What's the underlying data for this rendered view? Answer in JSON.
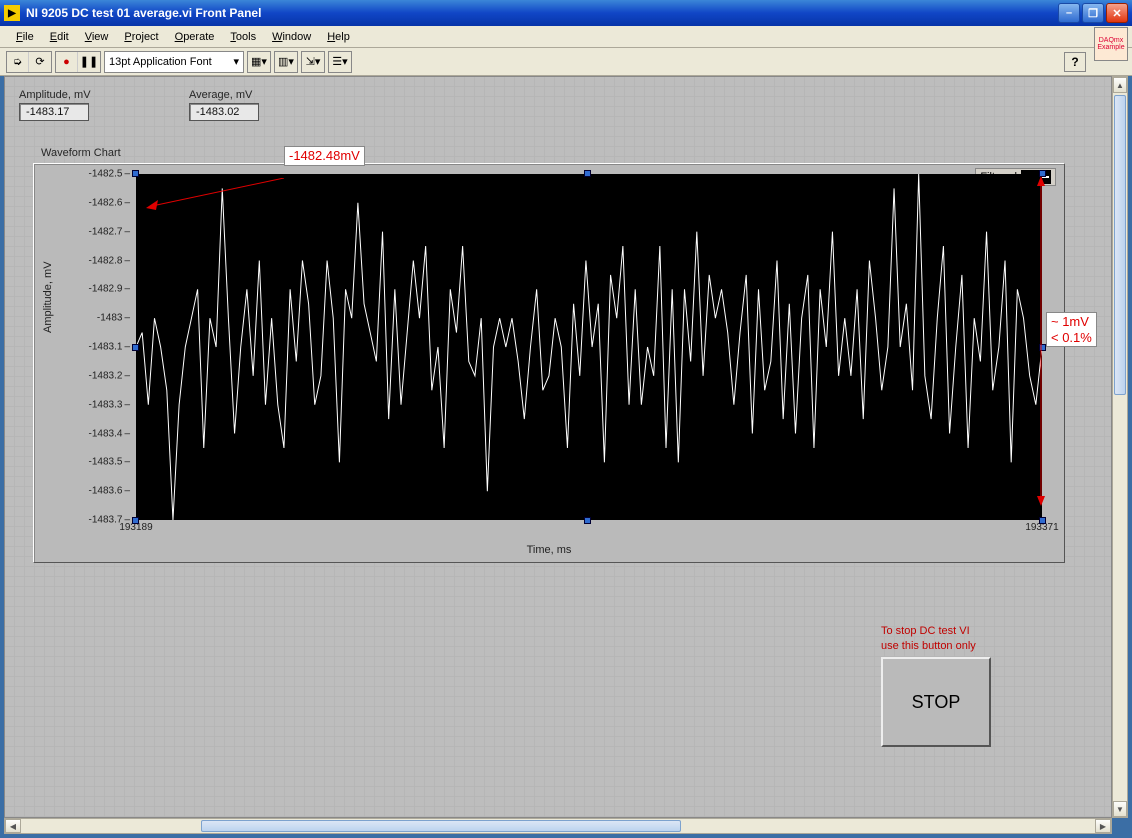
{
  "window": {
    "title": "NI 9205 DC test 01 average.vi Front Panel"
  },
  "menu": [
    "File",
    "Edit",
    "View",
    "Project",
    "Operate",
    "Tools",
    "Window",
    "Help"
  ],
  "toolbar": {
    "font": "13pt Application Font"
  },
  "indicators": {
    "amplitude": {
      "label": "Amplitude, mV",
      "value": "-1483.17"
    },
    "average": {
      "label": "Average, mV",
      "value": "-1483.02"
    }
  },
  "chart": {
    "title": "Waveform Chart",
    "legend_label": "Filtered",
    "ylabel": "Amplitude, mV",
    "xlabel": "Time, ms",
    "y_ticks": [
      "-1482.5",
      "-1482.6",
      "-1482.7",
      "-1482.8",
      "-1482.9",
      "-1483",
      "-1483.1",
      "-1483.2",
      "-1483.3",
      "-1483.4",
      "-1483.5",
      "-1483.6",
      "-1483.7"
    ],
    "x_min": "193189",
    "x_max": "193371"
  },
  "chart_data": {
    "type": "line",
    "x_range": [
      193189,
      193371
    ],
    "ylim": [
      -1483.7,
      -1482.5
    ],
    "series": [
      {
        "name": "Filtered",
        "color": "#ffffff",
        "values": [
          -1483.1,
          -1483.05,
          -1483.3,
          -1483.0,
          -1483.1,
          -1483.25,
          -1483.7,
          -1483.3,
          -1483.1,
          -1483.0,
          -1482.9,
          -1483.45,
          -1483.0,
          -1483.1,
          -1482.55,
          -1483.0,
          -1483.4,
          -1483.1,
          -1482.9,
          -1483.2,
          -1482.8,
          -1483.3,
          -1483.0,
          -1483.3,
          -1483.45,
          -1482.9,
          -1483.15,
          -1482.8,
          -1482.95,
          -1483.3,
          -1483.2,
          -1482.8,
          -1483.0,
          -1483.5,
          -1482.9,
          -1483.0,
          -1482.6,
          -1482.95,
          -1483.05,
          -1483.15,
          -1482.7,
          -1483.35,
          -1482.9,
          -1483.3,
          -1483.05,
          -1482.8,
          -1483.0,
          -1482.75,
          -1483.25,
          -1483.1,
          -1483.45,
          -1482.9,
          -1483.05,
          -1482.75,
          -1483.15,
          -1483.2,
          -1483.0,
          -1483.6,
          -1483.1,
          -1483.0,
          -1483.1,
          -1483.0,
          -1483.15,
          -1483.35,
          -1483.1,
          -1482.9,
          -1483.25,
          -1483.2,
          -1483.0,
          -1483.1,
          -1483.45,
          -1482.95,
          -1483.2,
          -1482.8,
          -1483.1,
          -1482.95,
          -1483.5,
          -1482.85,
          -1483.0,
          -1482.75,
          -1483.3,
          -1482.9,
          -1483.3,
          -1483.1,
          -1483.2,
          -1482.75,
          -1483.45,
          -1482.9,
          -1483.5,
          -1482.9,
          -1483.15,
          -1482.7,
          -1483.2,
          -1482.85,
          -1483.0,
          -1482.9,
          -1483.05,
          -1483.3,
          -1483.05,
          -1482.85,
          -1483.4,
          -1482.9,
          -1483.25,
          -1483.15,
          -1482.8,
          -1483.35,
          -1482.95,
          -1483.4,
          -1483.0,
          -1482.85,
          -1483.45,
          -1482.9,
          -1483.1,
          -1482.7,
          -1483.2,
          -1483.0,
          -1483.2,
          -1482.9,
          -1483.35,
          -1482.8,
          -1483.0,
          -1483.25,
          -1483.1,
          -1482.55,
          -1483.1,
          -1482.95,
          -1483.25,
          -1482.5,
          -1483.2,
          -1483.35,
          -1483.0,
          -1482.75,
          -1483.4,
          -1483.1,
          -1482.85,
          -1483.45,
          -1483.0,
          -1483.15,
          -1482.7,
          -1483.25,
          -1483.1,
          -1482.8,
          -1483.5,
          -1482.9,
          -1483.0,
          -1483.2,
          -1483.3,
          -1483.1
        ]
      }
    ],
    "xlabel": "Time, ms",
    "ylabel": "Amplitude, mV",
    "title": "Waveform Chart"
  },
  "stop": {
    "hint_line1": "To stop DC test VI",
    "hint_line2": "use this button only",
    "label": "STOP"
  },
  "annotations": {
    "peak": "-1482.48mV",
    "range_l1": "~ 1mV",
    "range_l2": "< 0.1%"
  },
  "daqmx": {
    "l1": "DAQmx",
    "l2": "Example"
  }
}
